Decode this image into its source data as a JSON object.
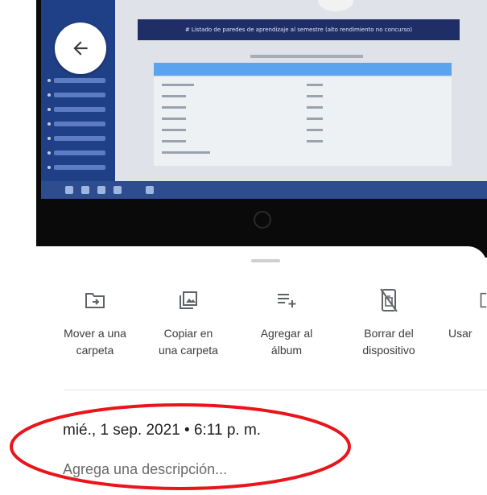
{
  "photo": {
    "laptop_header_text": "# Listado de paredes de aprendizaje al semestre (alto rendimiento no concurso)"
  },
  "navigation": {
    "back_icon": "arrow-back-icon"
  },
  "actions": [
    {
      "icon": "folder-move-icon",
      "label_line1": "Mover a una",
      "label_line2": "carpeta"
    },
    {
      "icon": "copy-folder-icon",
      "label_line1": "Copiar en",
      "label_line2": "una carpeta"
    },
    {
      "icon": "playlist-add-icon",
      "label_line1": "Agregar al",
      "label_line2": "álbum"
    },
    {
      "icon": "delete-from-device-icon",
      "label_line1": "Borrar del",
      "label_line2": "dispositivo"
    },
    {
      "icon": "use-as-icon",
      "label_line1": "Usar",
      "label_line2": ""
    }
  ],
  "details": {
    "date_time": "mié., 1 sep. 2021 • 6:11 p. m.",
    "description_placeholder": "Agrega una descripción..."
  },
  "annotation": {
    "color": "#e8151b"
  }
}
